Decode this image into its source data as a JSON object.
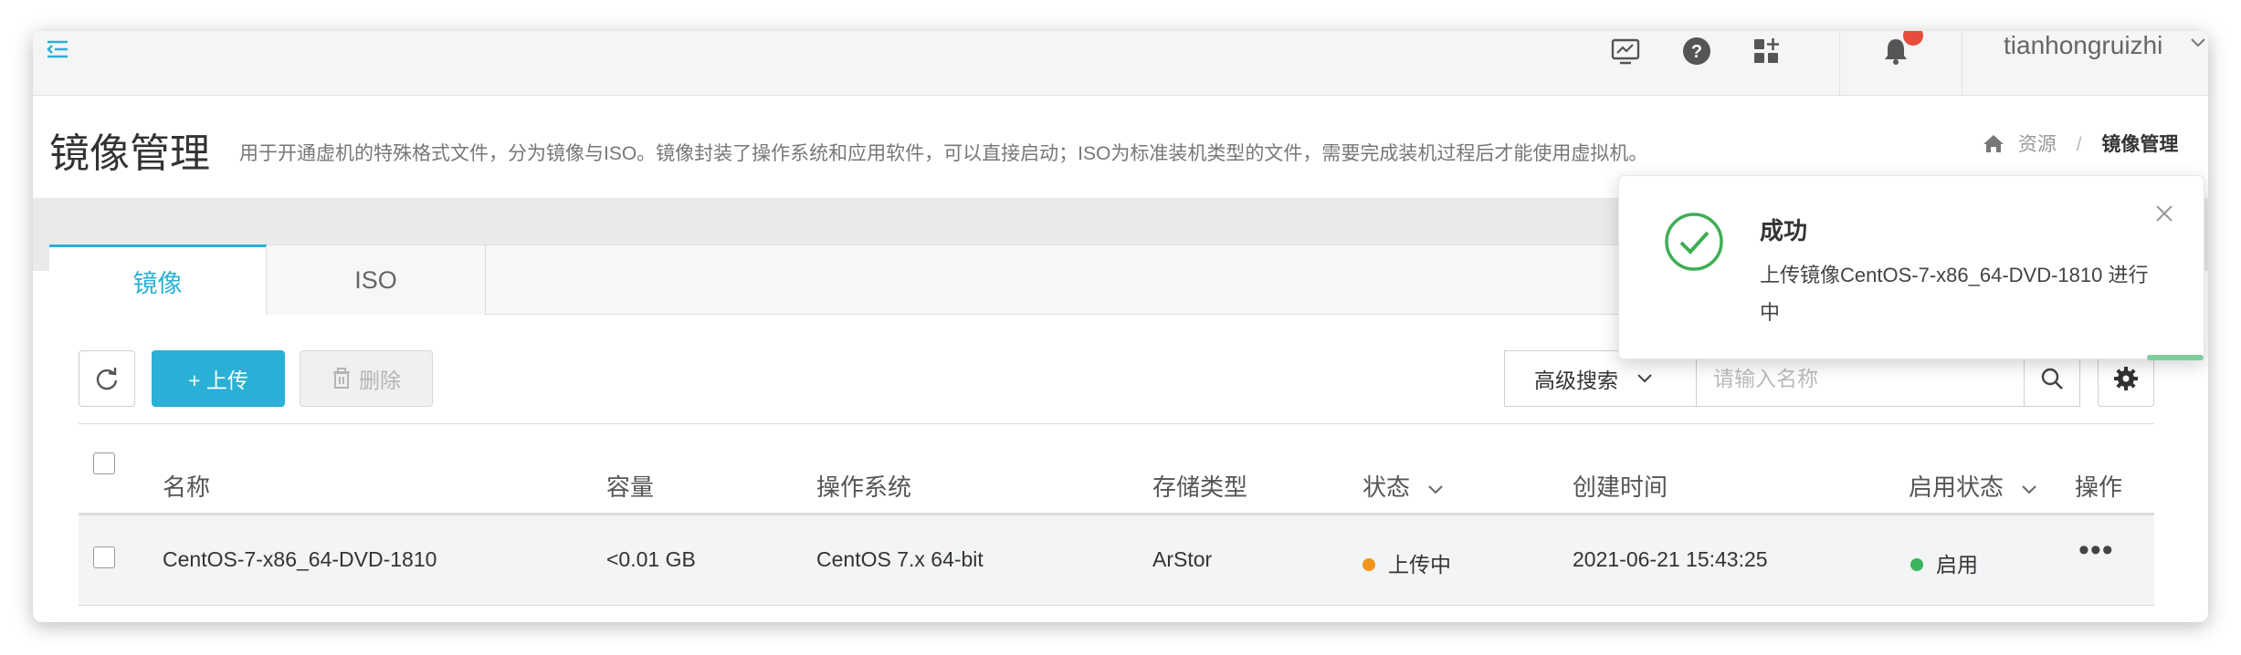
{
  "topbar": {
    "username": "tianhongruizhi",
    "icons": [
      "menu-toggle-icon",
      "monitor-icon",
      "help-icon",
      "apps-icon",
      "bell-icon",
      "chevron-down-icon"
    ],
    "accent_color": "#2ab0d6",
    "badge_color": "#e84c3d"
  },
  "header": {
    "title": "镜像管理",
    "description": "用于开通虚机的特殊格式文件，分为镜像与ISO。镜像封装了操作系统和应用软件，可以直接启动；ISO为标准装机类型的文件，需要完成装机过程后才能使用虚拟机。",
    "breadcrumb": {
      "home": "资源",
      "separator": "/",
      "current": "镜像管理"
    }
  },
  "tabs": [
    {
      "label": "镜像",
      "active": true
    },
    {
      "label": "ISO",
      "active": false
    }
  ],
  "toolbar": {
    "upload_label": "+ 上传",
    "delete_label": "删除",
    "advanced_search_label": "高级搜索",
    "search_placeholder": "请输入名称"
  },
  "table": {
    "columns": [
      "名称",
      "容量",
      "操作系统",
      "存储类型",
      "状态",
      "创建时间",
      "启用状态",
      "操作"
    ],
    "rows": [
      {
        "name": "CentOS-7-x86_64-DVD-1810",
        "size": "<0.01 GB",
        "os": "CentOS 7.x 64-bit",
        "storage": "ArStor",
        "status": "上传中",
        "status_color": "#f0951f",
        "created": "2021-06-21 15:43:25",
        "enabled": "启用",
        "enabled_color": "#3cb55e"
      }
    ]
  },
  "toast": {
    "title": "成功",
    "message": "上传镜像CentOS-7-x86_64-DVD-1810 进行中",
    "icon_color": "#3fae55"
  }
}
